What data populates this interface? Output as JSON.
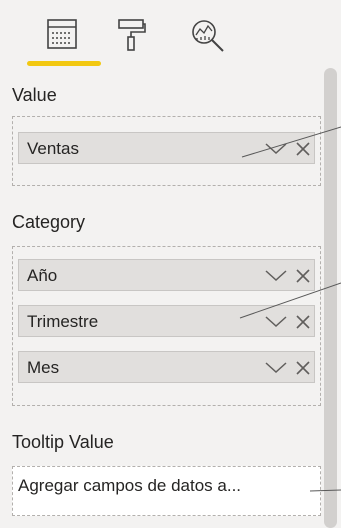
{
  "toolbar": {
    "tabs": [
      {
        "icon": "fields-icon",
        "active": true
      },
      {
        "icon": "format-paint-roller-icon",
        "active": false
      },
      {
        "icon": "analytics-magnifier-icon",
        "active": false
      }
    ],
    "accent_color": "#f2c811"
  },
  "sections": {
    "value": {
      "title": "Value",
      "fields": [
        {
          "label": "Ventas"
        }
      ]
    },
    "category": {
      "title": "Category",
      "fields": [
        {
          "label": "Año"
        },
        {
          "label": "Trimestre"
        },
        {
          "label": "Mes"
        }
      ]
    },
    "tooltip": {
      "title": "Tooltip Value",
      "placeholder": "Agregar campos de datos a..."
    }
  },
  "colors": {
    "pane_background": "#f3f2f1",
    "pill_background": "#e1dfdd",
    "well_border": "#b3b0ad"
  }
}
